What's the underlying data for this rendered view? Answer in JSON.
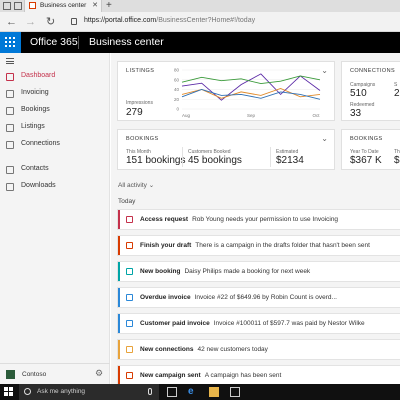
{
  "browser": {
    "tab_title": "Business center",
    "url_host": "https://portal.office.com",
    "url_path": "/BusinessCenter?Home#!/today"
  },
  "header": {
    "brand": "Office 365",
    "app_title": "Business center"
  },
  "sidebar": {
    "items": [
      {
        "label": "Dashboard",
        "icon": "dashboard-icon",
        "active": true
      },
      {
        "label": "Invoicing",
        "icon": "invoice-icon",
        "active": false
      },
      {
        "label": "Bookings",
        "icon": "calendar-icon",
        "active": false
      },
      {
        "label": "Listings",
        "icon": "listings-icon",
        "active": false
      },
      {
        "label": "Connections",
        "icon": "connections-icon",
        "active": false
      },
      {
        "label": "Contacts",
        "icon": "contacts-icon",
        "active": false
      },
      {
        "label": "Downloads",
        "icon": "download-icon",
        "active": false
      }
    ],
    "org": "Contoso"
  },
  "cards": {
    "listings": {
      "title": "LISTINGS",
      "impressions_label": "Impressions",
      "impressions_value": "279"
    },
    "connections": {
      "title": "CONNECTIONS",
      "campaigns_label": "Campaigns",
      "campaigns_value": "510",
      "redeemed_label": "Redeemed",
      "redeemed_value": "33",
      "clipped_label": "S",
      "clipped_value": "2"
    },
    "bookings": {
      "title": "BOOKINGS",
      "this_month_label": "This Month",
      "this_month_value": "151 bookings",
      "customers_label": "Customers Booked",
      "customers_value": "45 bookings",
      "estimated_label": "Estimated",
      "estimated_value": "$2134"
    },
    "bookings2": {
      "title": "BOOKINGS",
      "ytd_label": "Year To Date",
      "ytd_value": "$367 K",
      "clipped_label": "Th",
      "clipped_value": "$1"
    }
  },
  "chart_data": {
    "type": "line",
    "x_labels": [
      "Aug",
      "Sep",
      "Oct"
    ],
    "y_ticks": [
      0,
      20,
      40,
      60,
      80
    ],
    "ylim": [
      0,
      80
    ],
    "grid": true,
    "series": [
      {
        "color": "#5b2aa6",
        "values": [
          47,
          53,
          18,
          50,
          72,
          30,
          68,
          38
        ]
      },
      {
        "color": "#3a9a3a",
        "values": [
          55,
          65,
          58,
          62,
          52,
          57,
          68,
          60
        ]
      },
      {
        "color": "#e08a2a",
        "values": [
          30,
          40,
          22,
          35,
          28,
          42,
          25,
          30
        ]
      },
      {
        "color": "#2f6fb3",
        "values": [
          25,
          40,
          28,
          30,
          22,
          35,
          30,
          20
        ]
      }
    ]
  },
  "activity": {
    "filter_label": "All activity",
    "section_label": "Today",
    "items": [
      {
        "title": "Access request",
        "text": "Rob Young needs your permission to use Invoicing",
        "color": "#c4314b"
      },
      {
        "title": "Finish your draft",
        "text": "There is a campaign in the drafts folder that hasn't been sent",
        "color": "#d83b01"
      },
      {
        "title": "New booking",
        "text": "Daisy Philips made a booking for next week",
        "color": "#00a4a6"
      },
      {
        "title": "Overdue invoice",
        "text": "Invoice #22 of $649.96 by Robin Count is overd...",
        "color": "#2b88d8"
      },
      {
        "title": "Customer paid invoice",
        "text": "Invoice #100011 of $597.7 was paid by Nestor Wilke",
        "color": "#2b88d8"
      },
      {
        "title": "New connections",
        "text": "42 new customers today",
        "color": "#e8a33c"
      },
      {
        "title": "New campaign sent",
        "text": "A campaign has been sent",
        "color": "#d83b01"
      }
    ]
  },
  "taskbar": {
    "search_placeholder": "Ask me anything"
  }
}
